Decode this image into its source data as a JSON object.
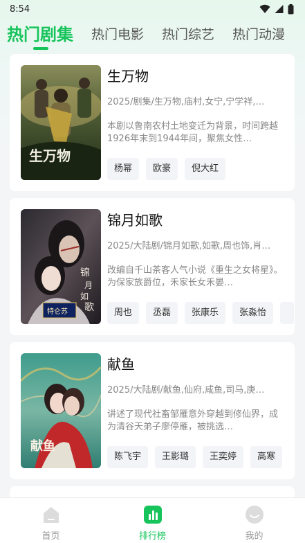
{
  "status_bar": {
    "time": "8:54",
    "icons": [
      "wifi-icon",
      "signal-icon",
      "battery-icon"
    ]
  },
  "tabs": [
    {
      "label": "热门剧集",
      "active": true
    },
    {
      "label": "热门电影",
      "active": false
    },
    {
      "label": "热门综艺",
      "active": false
    },
    {
      "label": "热门动漫",
      "active": false
    }
  ],
  "shows": [
    {
      "title": "生万物",
      "meta": "2025/剧集/生万物,庙村,女宁,宁学祥,…",
      "desc": "本剧以鲁南农村土地变迁为背景，时间跨越1926年末到1944年间，聚焦女性…",
      "actors": [
        "杨幂",
        "欧豪",
        "倪大红"
      ],
      "poster_text": "生万物"
    },
    {
      "title": "锦月如歌",
      "meta": "2025/大陆剧/锦月如歌,如歌,周也饰,肖…",
      "desc": "改编自千山茶客人气小说《重生之女将星》。为保家族爵位，禾家长女禾晏…",
      "actors": [
        "周也",
        "丞磊",
        "张康乐",
        "张淼怡",
        ""
      ],
      "poster_text": "锦月如歌",
      "poster_badge": "特仑苏"
    },
    {
      "title": "献鱼",
      "meta": "2025/大陆剧/献鱼,仙府,咸鱼,司马,庚…",
      "desc": "讲述了现代社畜邹雁意外穿越到修仙界，成为清谷天弟子廖停雁，被挑选…",
      "actors": [
        "陈飞宇",
        "王影璐",
        "王奕婷",
        "高寒"
      ],
      "poster_text": "献鱼"
    }
  ],
  "bottom_nav": [
    {
      "label": "首页",
      "icon": "home-icon",
      "active": false
    },
    {
      "label": "排行榜",
      "icon": "chart-icon",
      "active": true
    },
    {
      "label": "我的",
      "icon": "profile-icon",
      "active": false
    }
  ],
  "colors": {
    "accent": "#16c45b",
    "background": "#f4f5f7"
  }
}
